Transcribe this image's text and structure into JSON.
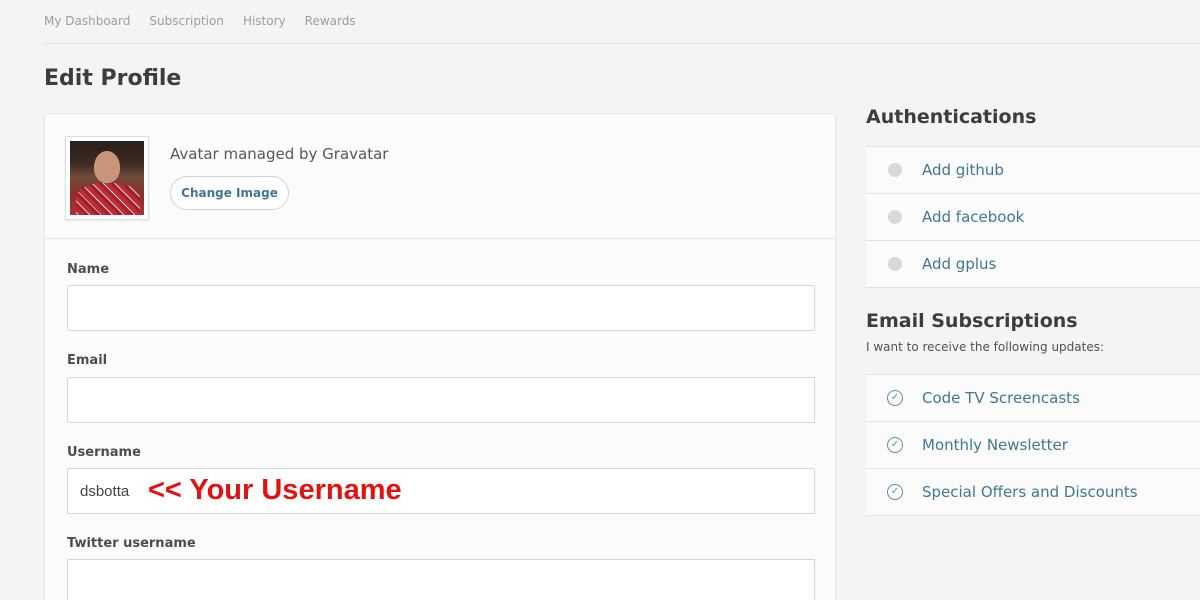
{
  "nav": {
    "items": [
      "My Dashboard",
      "Subscription",
      "History",
      "Rewards"
    ]
  },
  "page": {
    "title": "Edit Profile"
  },
  "avatar": {
    "text": "Avatar managed by Gravatar",
    "change_button": "Change Image"
  },
  "form": {
    "name_label": "Name",
    "name_value": "",
    "email_label": "Email",
    "email_value": "",
    "username_label": "Username",
    "username_value": "dsbotta",
    "username_annotation": "<< Your Username",
    "twitter_label": "Twitter username",
    "twitter_value": ""
  },
  "authentications": {
    "title": "Authentications",
    "items": [
      "Add github",
      "Add facebook",
      "Add gplus"
    ]
  },
  "subscriptions": {
    "title": "Email Subscriptions",
    "subtitle": "I want to receive the following updates:",
    "items": [
      "Code TV Screencasts",
      "Monthly Newsletter",
      "Special Offers and Discounts"
    ]
  },
  "colors": {
    "link": "#3f7890",
    "annotation": "#e31212",
    "background": "#f4f4f4"
  }
}
